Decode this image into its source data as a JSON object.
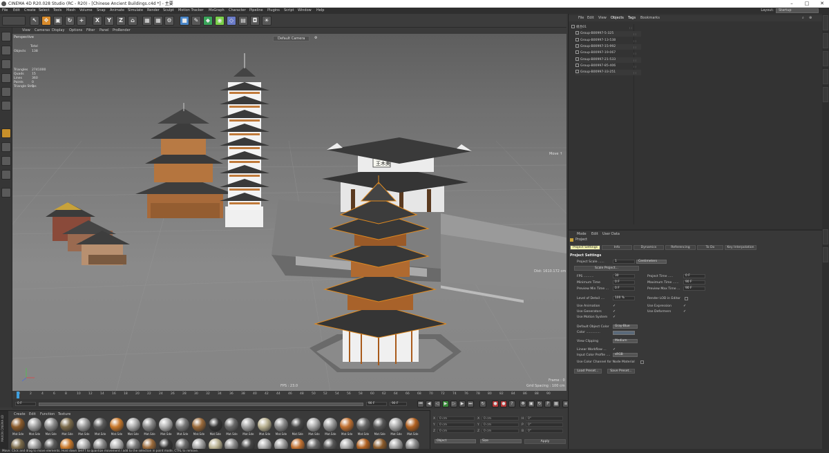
{
  "titlebar": {
    "title": "CINEMA 4D R20.028 Studio (RC - R20) - [Chinese Ancient Buildings.c4d *] - 主要",
    "min": "–",
    "max": "□",
    "close": "✕"
  },
  "menubar": {
    "items": [
      "File",
      "Edit",
      "Create",
      "Select",
      "Tools",
      "Mesh",
      "Volume",
      "Snap",
      "Animate",
      "Simulate",
      "Render",
      "Sculpt",
      "Motion Tracker",
      "MoGraph",
      "Character",
      "Pipeline",
      "Plugins",
      "Script",
      "Window",
      "Help"
    ],
    "layout_label": "Layout:",
    "layout_value": "Startup"
  },
  "toolbar": {
    "axis_x": "X",
    "axis_y": "Y",
    "axis_z": "Z"
  },
  "viewport": {
    "menu": [
      "View",
      "Cameras",
      "Display",
      "Options",
      "Filter",
      "Panel",
      "ProRender"
    ],
    "name": "Perspective",
    "camera": "Default Camera",
    "camera_icon": "⚙",
    "move_label": "Move ↑",
    "dist_label": "Dist: 1610.172 cm",
    "fps": "FPS : 23.0",
    "frame": "Frame : 0",
    "grid": "Grid Spacing : 100 cm",
    "stats_head": "Total",
    "stats": [
      {
        "k": "Objects",
        "v": "138"
      },
      {
        "k": "Triangles",
        "v": "2741000"
      },
      {
        "k": "Quads",
        "v": "15"
      },
      {
        "k": "Lines",
        "v": "360"
      },
      {
        "k": "Points",
        "v": "0"
      },
      {
        "k": "Triangle Strips",
        "v": "0"
      }
    ],
    "sign_text": "王木美"
  },
  "timeline": {
    "ticks": [
      "0",
      "2",
      "4",
      "6",
      "8",
      "10",
      "12",
      "14",
      "16",
      "18",
      "20",
      "22",
      "24",
      "26",
      "28",
      "30",
      "32",
      "34",
      "36",
      "38",
      "40",
      "42",
      "44",
      "46",
      "48",
      "50",
      "52",
      "54",
      "56",
      "58",
      "60",
      "62",
      "64",
      "66",
      "68",
      "70",
      "72",
      "74",
      "76",
      "78",
      "80",
      "82",
      "84",
      "86",
      "88",
      "90"
    ],
    "start": "0 F",
    "current": "0 F",
    "end": "90 F",
    "end2": "90 F"
  },
  "materials": {
    "menu": [
      "Create",
      "Edit",
      "Function",
      "Texture"
    ],
    "label": "Mat.Sde",
    "brand": "MAXON CINEMA 4D",
    "count_row1": 25,
    "count_row2": 25
  },
  "coords": {
    "rows": [
      {
        "a": "X",
        "b": "0 cm",
        "c": "X",
        "d": "0 cm",
        "e": "H",
        "f": "0°"
      },
      {
        "a": "Y",
        "b": "0 cm",
        "c": "Y",
        "d": "0 cm",
        "e": "P",
        "f": "0°"
      },
      {
        "a": "Z",
        "b": "0 cm",
        "c": "Z",
        "d": "0 cm",
        "e": "B",
        "f": "0°"
      }
    ],
    "mode1": "Object",
    "mode2": "Size",
    "apply": "Apply"
  },
  "status": "Move: Click and drag to move elements. Hold down SHIFT to quantize movement / add to the selection in point mode, CTRL to remove.",
  "objects": {
    "menu": [
      "File",
      "Edit",
      "View",
      "Objects",
      "Tags",
      "Bookmarks"
    ],
    "items": [
      "组合01",
      "Group-B00997-5-325",
      "Group-B00997-13-538",
      "Group-B00997-15-992",
      "Group-B00997-19-067",
      "Group-B00997-21-533",
      "Group-B00997-85-406",
      "Group-B00997-33-251"
    ]
  },
  "attributes": {
    "menu": [
      "Mode",
      "Edit",
      "User Data"
    ],
    "project": "Project",
    "tabs": [
      "Project Settings",
      "Info",
      "Dynamics",
      "Referencing",
      "To Do",
      "Key Interpolation"
    ],
    "section": "Project Settings",
    "project_scale_label": "Project Scale ......",
    "project_scale_value": "1",
    "project_scale_unit": "Centimeters",
    "scale_project_btn": "Scale Project...",
    "fps_label": "FPS ..........",
    "fps_value": "30",
    "min_time_label": "Minimum Time",
    "min_time_value": "0 F",
    "preview_min_label": "Preview Min Time ...",
    "preview_min_value": "0 F",
    "project_time_label": "Project Time .....",
    "project_time_value": "0 F",
    "max_time_label": "Maximum Time ......",
    "max_time_value": "90 F",
    "preview_max_label": "Preview Max Time ...",
    "preview_max_value": "90 F",
    "lod_label": "Level of Detail ....",
    "lod_value": "100 %",
    "render_lod_label": "Render LOD in Editor",
    "use_anim": "Use Animation",
    "use_gen": "Use Generators",
    "use_motion": "Use Motion System",
    "use_expr": "Use Expression",
    "use_deform": "Use Deformers",
    "def_color_label": "Default Object Color",
    "def_color_value": "Gray-Blue",
    "color_label": "Color ..............",
    "view_clip_label": "View Clipping",
    "view_clip_value": "Medium",
    "linear_label": "Linear Workflow ...",
    "input_profile_label": "Input Color Profile ....",
    "input_profile_value": "sRGB",
    "use_color_channel": "Use Color Channel for Node Material",
    "load_preset": "Load Preset...",
    "save_preset": "Save Preset...",
    "check": "✓"
  }
}
